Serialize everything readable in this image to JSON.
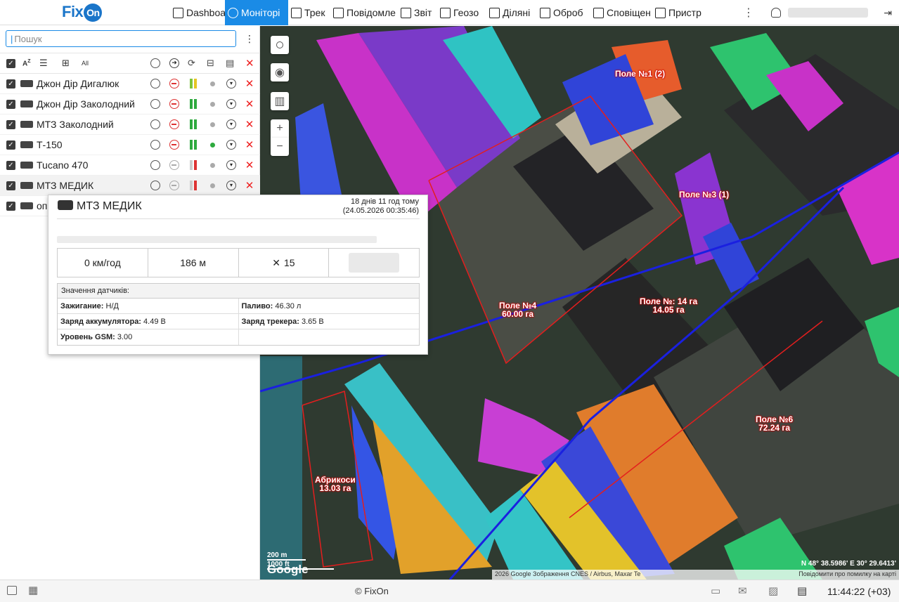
{
  "app": {
    "logo": "Fix",
    "logo_badge": "On"
  },
  "nav": [
    {
      "label": "Dashboa",
      "icon": "bar-chart-icon"
    },
    {
      "label": "Моніторі",
      "icon": "globe-icon",
      "active": true
    },
    {
      "label": "Трек",
      "icon": "checkered-flag-icon"
    },
    {
      "label": "Повідомле",
      "icon": "document-icon"
    },
    {
      "label": "Звіт",
      "icon": "report-icon"
    },
    {
      "label": "Геозо",
      "icon": "geofence-icon"
    },
    {
      "label": "Ділянi",
      "icon": "field-icon"
    },
    {
      "label": "Оброб",
      "icon": "processing-icon"
    },
    {
      "label": "Сповіщен",
      "icon": "alarm-icon"
    },
    {
      "label": "Пристр",
      "icon": "truck-icon"
    }
  ],
  "sidebar": {
    "search_placeholder": "Пошук",
    "units": [
      {
        "name": "Джон Дір Дигалюк",
        "stop": "red",
        "bars": [
          "#7cc43a",
          "#e5c623"
        ],
        "dot": "grey"
      },
      {
        "name": "Джон Дір Заколодний",
        "stop": "red",
        "bars": [
          "#2eaa3e",
          "#2eaa3e"
        ],
        "dot": "grey"
      },
      {
        "name": "МТЗ Заколодний",
        "stop": "red",
        "bars": [
          "#2eaa3e",
          "#2eaa3e"
        ],
        "dot": "grey"
      },
      {
        "name": "Т-150",
        "stop": "red",
        "bars": [
          "#2eaa3e",
          "#2eaa3e"
        ],
        "dot": "green"
      },
      {
        "name": "Tucano 470",
        "stop": "grey",
        "bars": [
          "#ccc",
          "#d33"
        ],
        "dot": "grey"
      },
      {
        "name": "МТЗ МЕДИК",
        "stop": "grey",
        "bars": [
          "#ccc",
          "#d33"
        ],
        "dot": "grey",
        "selected": true
      },
      {
        "name": "оп",
        "stop": "",
        "bars": [],
        "dot": ""
      }
    ]
  },
  "popup": {
    "title": "МТЗ МЕДИК",
    "time_ago": "18 днів 11 год тому",
    "timestamp": "(24.05.2026 00:35:46)",
    "speed": "0 км/год",
    "altitude": "186 м",
    "satellites": "15",
    "sensors_header": "Значення датчиків:",
    "sensors": [
      [
        {
          "k": "Зажигание:",
          "v": "Н/Д"
        },
        {
          "k": "Паливо:",
          "v": "46.30 л"
        }
      ],
      [
        {
          "k": "Заряд аккумулятора:",
          "v": "4.49 В"
        },
        {
          "k": "Заряд трекера:",
          "v": "3.65 В"
        }
      ],
      [
        {
          "k": "Уровень GSM:",
          "v": "3.00"
        },
        {
          "k": "",
          "v": ""
        }
      ]
    ]
  },
  "map": {
    "fields": [
      {
        "a": "Поле №4",
        "b": "60.00 га"
      },
      {
        "a": "Поле №: 14 га",
        "b": "14.05 га"
      },
      {
        "a": "Поле №6",
        "b": "72.24 га"
      },
      {
        "a": "Абрикоси",
        "b": "13.03 га"
      },
      {
        "a": "Поле №3 (1)",
        "b": ""
      },
      {
        "a": "Поле №1 (2)",
        "b": ""
      }
    ],
    "scale_200": "200 m",
    "scale_1000": "1000 ft",
    "google": "Google",
    "coords": "N 48° 38.5986' E 30° 29.6413'",
    "attribution": "2026 Google Зображення  CNES / Airbus, Maxar Te",
    "report": "Повідомити про помилку на карті"
  },
  "footer": {
    "copyright": "© FixOn",
    "clock": "11:44:22 (+03)"
  }
}
